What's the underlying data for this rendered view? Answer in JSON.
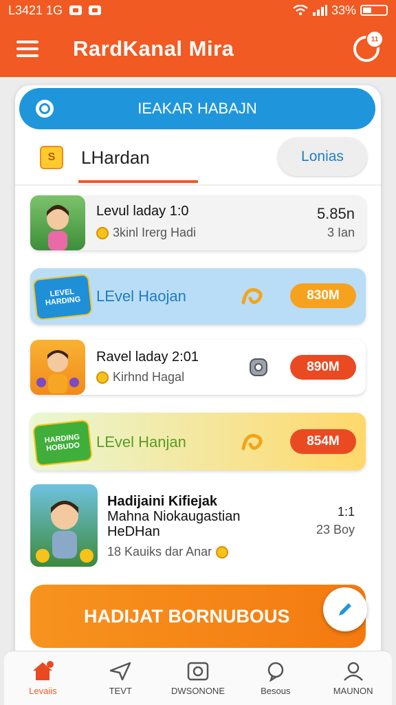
{
  "status_bar": {
    "time": "L3421 1G",
    "battery": "33%"
  },
  "app_bar": {
    "title": "RardKanal Mira",
    "badge": "11"
  },
  "search": {
    "label": "IEAKAR HABAJN"
  },
  "tabs": {
    "active_label": "LHardan",
    "active_icon_text": "S",
    "pill_label": "Lonias"
  },
  "items": [
    {
      "title": "Levul laday 1:0",
      "subtitle": "3kinl Irerg Hadi",
      "price": "5.85n",
      "meta": "3 Ian"
    },
    {
      "label": "LEvel Haojan",
      "tag": "830M",
      "thumb_text": "LEVEL HARDING",
      "tag_color": "#f7a21e"
    },
    {
      "title": "Ravel laday 2:01",
      "subtitle": "Kirhnd Hagal",
      "tag": "890M",
      "tag_color": "#ea4a22"
    },
    {
      "label": "LEvel Hanjan",
      "tag": "854M",
      "thumb_text": "HARDING HOBUDO",
      "tag_color": "#ea4a22"
    },
    {
      "title_line1": "Hadijaini Kifiejak",
      "title_line2": "Mahna Niokaugastian",
      "title_line3": "HeDHan",
      "subtitle": "18 Kauiks dar Anar",
      "price": "1:1",
      "meta": "23 Boy"
    }
  ],
  "cta": {
    "label": "HADIJAT BORNUBOUS"
  },
  "bottom_nav": [
    {
      "label": "Levaiis",
      "icon": "home-icon",
      "badge": "0"
    },
    {
      "label": "TEVT",
      "icon": "send-icon"
    },
    {
      "label": "DWSONONE",
      "icon": "camera-icon"
    },
    {
      "label": "Besous",
      "icon": "chat-icon"
    },
    {
      "label": "MAUNON",
      "icon": "profile-icon"
    }
  ]
}
